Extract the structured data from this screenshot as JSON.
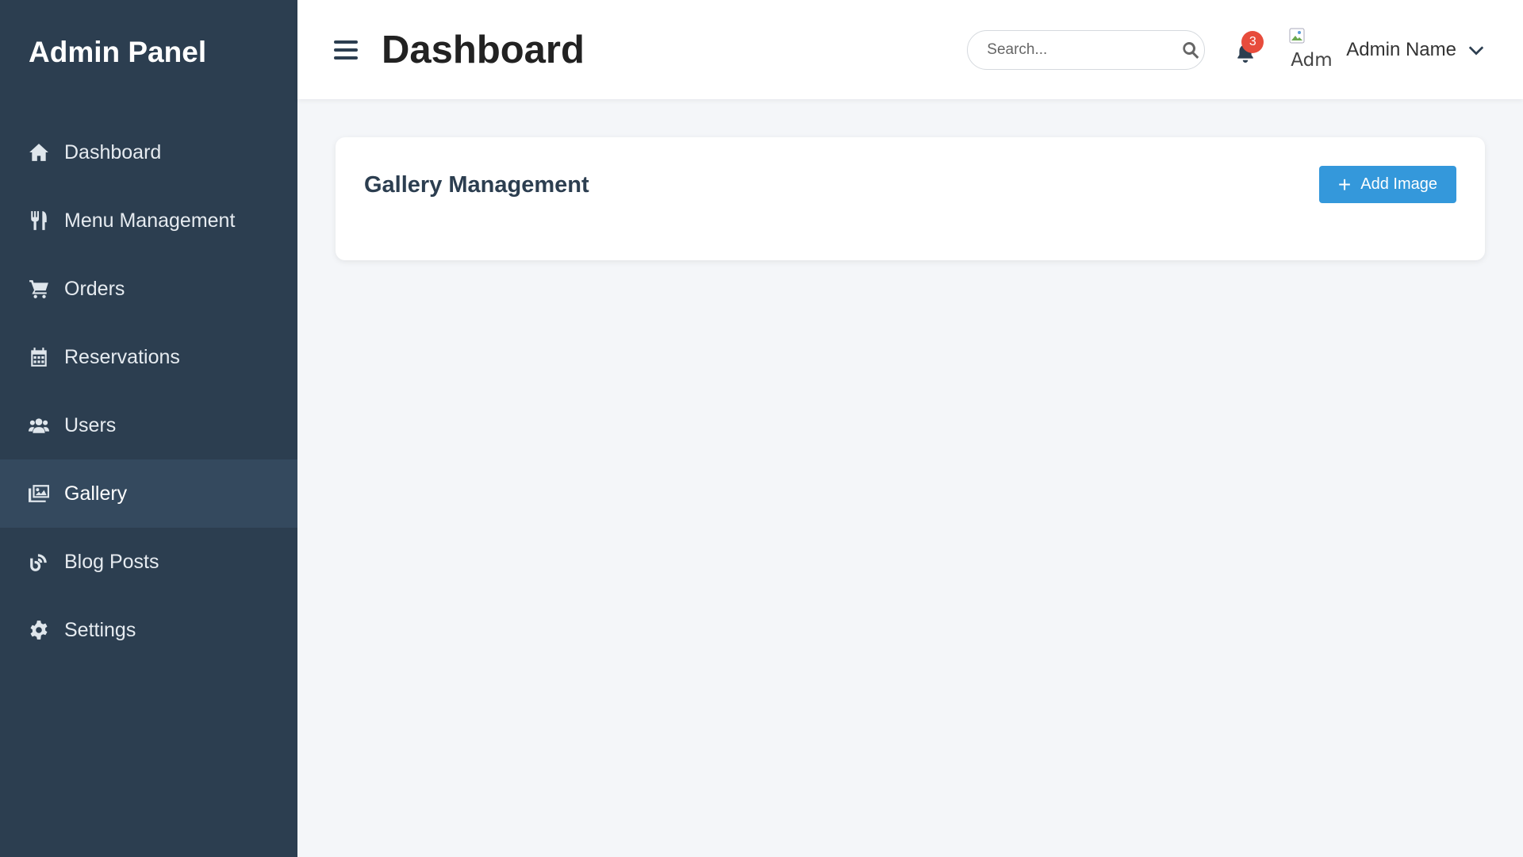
{
  "sidebar": {
    "brand": "Admin Panel",
    "items": [
      {
        "label": "Dashboard",
        "icon": "home-icon"
      },
      {
        "label": "Menu Management",
        "icon": "utensils-icon"
      },
      {
        "label": "Orders",
        "icon": "cart-icon"
      },
      {
        "label": "Reservations",
        "icon": "calendar-icon"
      },
      {
        "label": "Users",
        "icon": "users-icon"
      },
      {
        "label": "Gallery",
        "icon": "images-icon",
        "active": true
      },
      {
        "label": "Blog Posts",
        "icon": "blog-icon"
      },
      {
        "label": "Settings",
        "icon": "gear-icon"
      }
    ]
  },
  "header": {
    "title": "Dashboard",
    "search_placeholder": "Search...",
    "notification_count": "3",
    "avatar_alt": "Admin",
    "user_name": "Admin Name"
  },
  "main": {
    "card_title": "Gallery Management",
    "add_button_label": "Add Image"
  },
  "colors": {
    "sidebar_bg": "#2c3e50",
    "sidebar_active": "#34495e",
    "accent": "#3498db",
    "badge": "#e74c3c"
  }
}
